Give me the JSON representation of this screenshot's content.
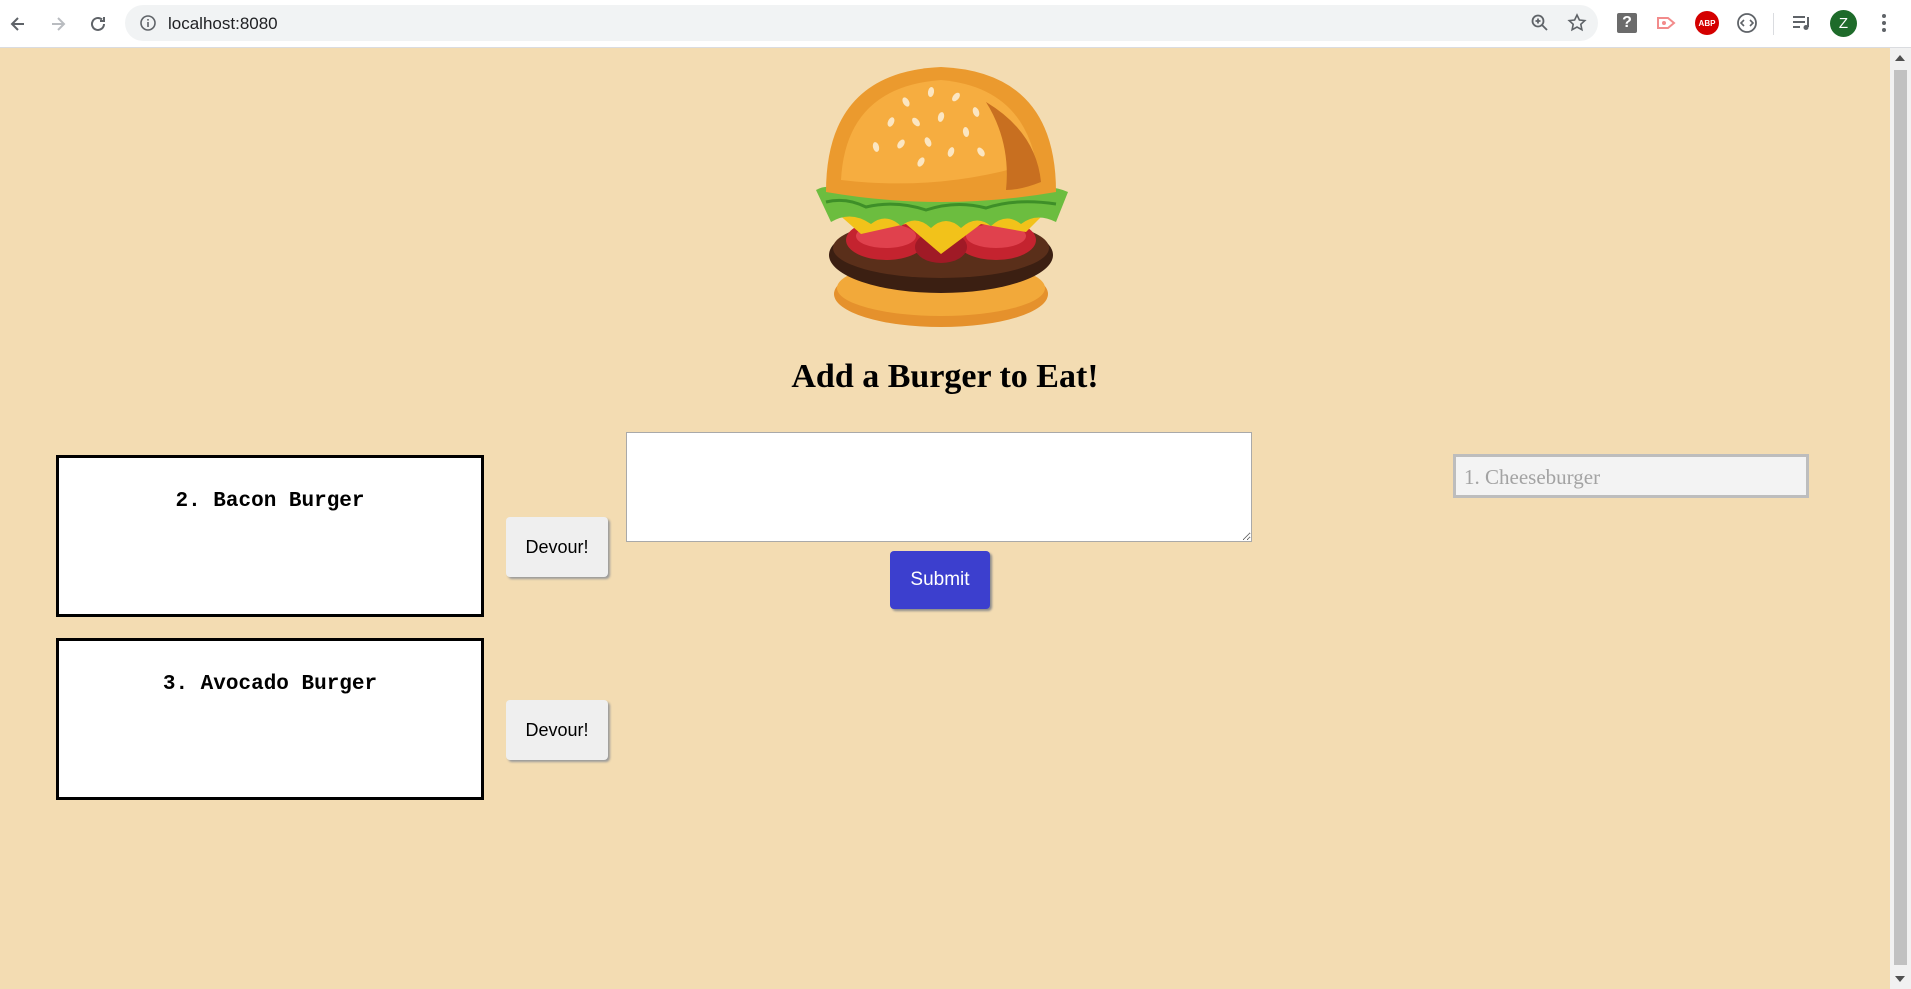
{
  "browser": {
    "url": "localhost:8080",
    "profile_initial": "Z",
    "extension_help_label": "?",
    "extension_abp_label": "ABP"
  },
  "page": {
    "heading": "Add a Burger to Eat!",
    "burgers_to_eat": [
      {
        "label": "2. Bacon Burger",
        "button": "Devour!"
      },
      {
        "label": "3. Avocado Burger",
        "button": "Devour!"
      }
    ],
    "input": {
      "value": "",
      "placeholder": ""
    },
    "submit_label": "Submit",
    "devoured": [
      {
        "label": "1. Cheeseburger"
      }
    ]
  },
  "colors": {
    "background": "#f3dcb2",
    "submit": "#3c3fce"
  }
}
